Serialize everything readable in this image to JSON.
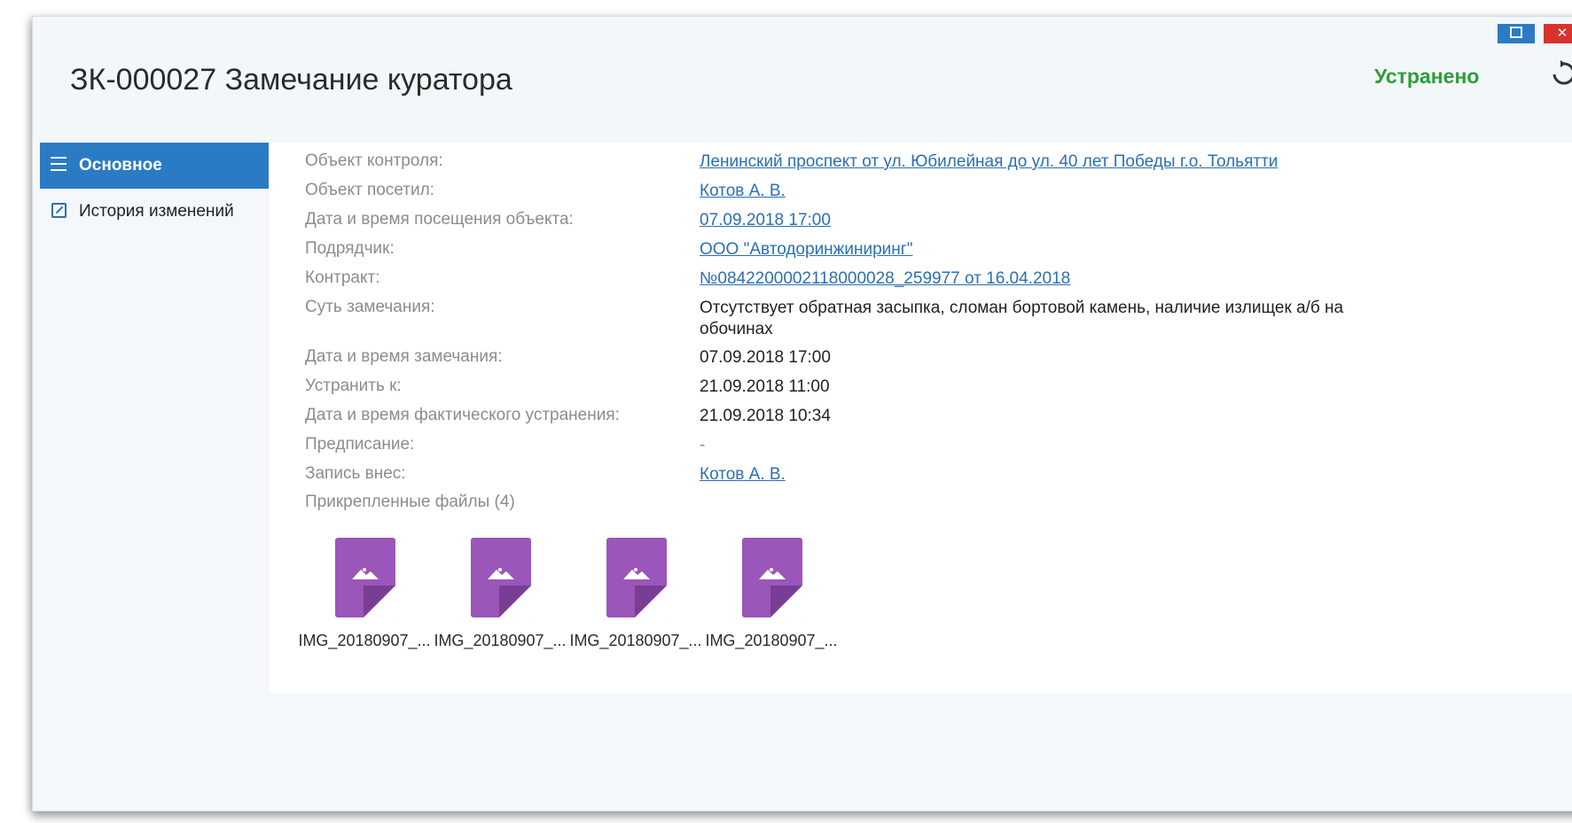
{
  "window": {
    "title": "ЗК-000027 Замечание куратора",
    "status": "Устранено",
    "status_color": "#2e9d3a",
    "accent_color": "#2b7bc4",
    "close_glyph": "✕",
    "refresh_icon": "refresh-icon"
  },
  "sidebar": {
    "items": [
      {
        "label": "Основное",
        "icon": "menu-icon",
        "active": true
      },
      {
        "label": "История изменений",
        "icon": "edit-icon",
        "active": false
      }
    ]
  },
  "details": {
    "object_label": "Объект контроля:",
    "object_value": "Ленинский  проспект от ул. Юбилейная до ул. 40 лет Победы г.о. Тольятти",
    "visited_by_label": "Объект посетил:",
    "visited_by_value": "Котов А. В.",
    "visit_datetime_label": "Дата и время посещения объекта:",
    "visit_datetime_value": "07.09.2018 17:00",
    "contractor_label": "Подрядчик:",
    "contractor_value": "ООО \"Автодоринжиниринг\"",
    "contract_label": "Контракт:",
    "contract_value": "№0842200002118000028_259977 от 16.04.2018",
    "essence_label": "Суть замечания:",
    "essence_value": "Отсутствует обратная засыпка, сломан бортовой камень, наличие излищек а/б на обочинах",
    "remark_datetime_label": "Дата и время замечания:",
    "remark_datetime_value": "07.09.2018 17:00",
    "fix_by_label": "Устранить к:",
    "fix_by_value": "21.09.2018 11:00",
    "actual_fix_label": "Дата и время фактического устранения:",
    "actual_fix_value": "21.09.2018 10:34",
    "prescription_label": "Предписание:",
    "prescription_value": "-",
    "entered_by_label": "Запись внес:",
    "entered_by_value": "Котов А. В."
  },
  "attachments": {
    "label": "Прикрепленные файлы (4)",
    "icon_color": "#9a56b8",
    "files": [
      {
        "name": "IMG_20180907_..."
      },
      {
        "name": "IMG_20180907_..."
      },
      {
        "name": "IMG_20180907_..."
      },
      {
        "name": "IMG_20180907_..."
      }
    ]
  }
}
